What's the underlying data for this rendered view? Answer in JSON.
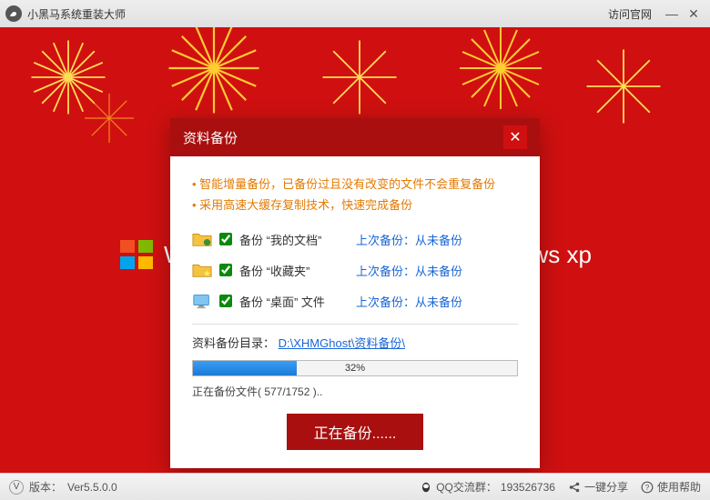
{
  "titlebar": {
    "app_name": "小黑马系统重装大师",
    "site_link": "访问官网"
  },
  "background": {
    "os_left": "W",
    "os_right": "ws xp"
  },
  "dialog": {
    "title": "资料备份",
    "bullet1": "智能增量备份，已备份过且没有改变的文件不会重复备份",
    "bullet2": "采用高速大缓存复制技术，快速完成备份",
    "rows": [
      {
        "label": "备份 “我的文档”",
        "status": "上次备份：从未备份",
        "checked": true
      },
      {
        "label": "备份 “收藏夹”",
        "status": "上次备份：从未备份",
        "checked": true
      },
      {
        "label": "备份 “桌面” 文件",
        "status": "上次备份：从未备份",
        "checked": true
      }
    ],
    "path_label": "资料备份目录：",
    "path": "D:\\XHMGhost\\资料备份\\",
    "progress_pct": "32%",
    "file_status": "正在备份文件( 577/1752 )..",
    "button": "正在备份......"
  },
  "statusbar": {
    "version_label": "版本：",
    "version": "Ver5.5.0.0",
    "qq_label": "QQ交流群：",
    "qq": "193526736",
    "share": "一键分享",
    "help": "使用帮助"
  }
}
